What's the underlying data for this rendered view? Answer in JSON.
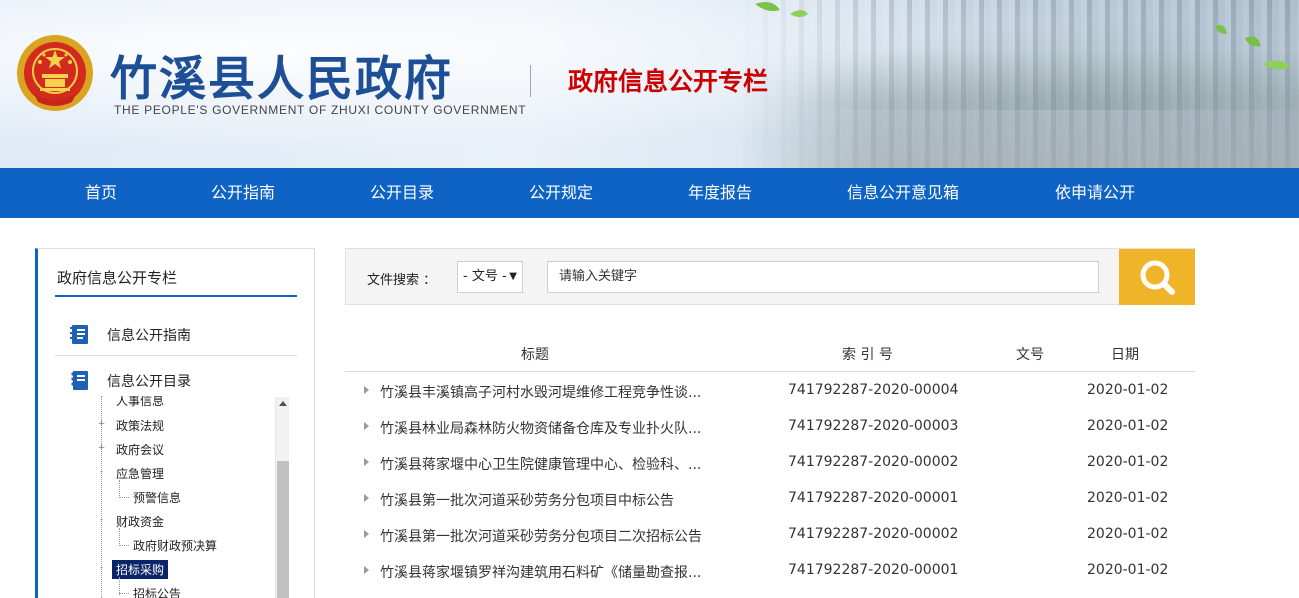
{
  "header": {
    "title": "竹溪县人民政府",
    "subtitle": "THE PEOPLE'S GOVERNMENT OF ZHUXI COUNTY GOVERNMENT",
    "column_title": "政府信息公开专栏",
    "emblem_icon": "national-emblem-icon"
  },
  "nav": {
    "items": [
      "首页",
      "公开指南",
      "公开目录",
      "公开规定",
      "年度报告",
      "信息公开意见箱",
      "依申请公开"
    ]
  },
  "sidebar": {
    "title": "政府信息公开专栏",
    "links": [
      {
        "label": "信息公开指南",
        "icon": "document-list-icon"
      },
      {
        "label": "信息公开目录",
        "icon": "notebook-icon"
      }
    ],
    "tree": [
      {
        "label": "人事信息",
        "toggle": ""
      },
      {
        "label": "政策法规",
        "toggle": "+"
      },
      {
        "label": "政府会议",
        "toggle": "+"
      },
      {
        "label": "应急管理",
        "toggle": "-"
      },
      {
        "label": "预警信息",
        "toggle": ""
      },
      {
        "label": "财政资金",
        "toggle": "-"
      },
      {
        "label": "政府财政预决算",
        "toggle": ""
      },
      {
        "label": "招标采购",
        "toggle": "-"
      },
      {
        "label": "招标公告",
        "toggle": ""
      }
    ]
  },
  "search": {
    "label": "文件搜索 ：",
    "select_value": "- 文号 -",
    "placeholder": "请输入关键字",
    "button_icon": "search-icon"
  },
  "table": {
    "headers": [
      "标题",
      "索 引 号",
      "文号",
      "日期"
    ],
    "rows": [
      {
        "title": "竹溪县丰溪镇高子河村水毁河堤维修工程竞争性谈...",
        "index": "741792287-2020-00004",
        "doc_no": "",
        "date": "2020-01-02"
      },
      {
        "title": "竹溪县林业局森林防火物资储备仓库及专业扑火队...",
        "index": "741792287-2020-00003",
        "doc_no": "",
        "date": "2020-01-02"
      },
      {
        "title": "竹溪县蒋家堰中心卫生院健康管理中心、检验科、...",
        "index": "741792287-2020-00002",
        "doc_no": "",
        "date": "2020-01-02"
      },
      {
        "title": "竹溪县第一批次河道采砂劳务分包项目中标公告",
        "index": "741792287-2020-00001",
        "doc_no": "",
        "date": "2020-01-02"
      },
      {
        "title": "竹溪县第一批次河道采砂劳务分包项目二次招标公告",
        "index": "741792287-2020-00002",
        "doc_no": "",
        "date": "2020-01-02"
      },
      {
        "title": "竹溪县蒋家堰镇罗祥沟建筑用石料矿《储量勘查报...",
        "index": "741792287-2020-00001",
        "doc_no": "",
        "date": "2020-01-02"
      }
    ]
  },
  "colors": {
    "nav_blue": "#0e63c4",
    "title_blue": "#1d4f96",
    "column_red": "#cc0000",
    "search_yellow": "#f0b429",
    "tree_selected": "#0a246a"
  }
}
